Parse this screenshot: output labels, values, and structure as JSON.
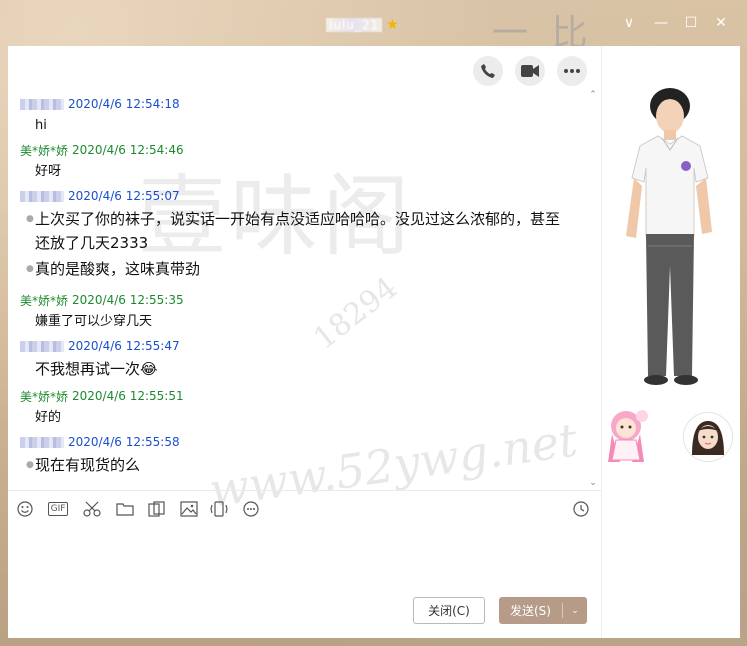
{
  "window": {
    "title": "lulu_21",
    "min_label": "—",
    "max_label": "☐",
    "close_label": "✕",
    "dropdown_label": "∨",
    "deco_text": "一 比"
  },
  "toolbar_top": {
    "phone_icon": "phone-icon",
    "video_icon": "video-icon",
    "more_icon": "more-icon"
  },
  "messages": [
    {
      "sender": "self",
      "name": "",
      "timestamp": "2020/4/6 12:54:18",
      "text": "hi"
    },
    {
      "sender": "other",
      "name": "美*娇*娇",
      "timestamp": "2020/4/6 12:54:46",
      "text": "好呀"
    },
    {
      "sender": "self",
      "name": "",
      "timestamp": "2020/4/6 12:55:07",
      "text": "上次买了你的袜子，说实话一开始有点没适应哈哈哈。没见过这么浓郁的，甚至还放了几天2333",
      "text2": "真的是酸爽，这味真带劲"
    },
    {
      "sender": "other",
      "name": "美*娇*娇",
      "timestamp": "2020/4/6 12:55:35",
      "text": "嫌重了可以少穿几天"
    },
    {
      "sender": "self",
      "name": "",
      "timestamp": "2020/4/6 12:55:47",
      "text": "不我想再试一次😂"
    },
    {
      "sender": "other",
      "name": "美*娇*娇",
      "timestamp": "2020/4/6 12:55:51",
      "text": "好的"
    },
    {
      "sender": "self",
      "name": "",
      "timestamp": "2020/4/6 12:55:58",
      "text": "现在有现货的么"
    }
  ],
  "input_toolbar": {
    "emoji": "emoji-icon",
    "gif_label": "GIF",
    "scissors": "scissors-icon",
    "folder": "folder-icon",
    "sticker": "sticker-icon",
    "image": "image-icon",
    "shake": "shake-icon",
    "more": "more-icon",
    "history": "clock-icon"
  },
  "buttons": {
    "close_label": "关闭(C)",
    "send_label": "发送(S)",
    "send_arrow": "⌄"
  },
  "watermark": {
    "big_text": "壹味阁",
    "url_text": "www.52ywg.net",
    "num_text": "18294"
  }
}
